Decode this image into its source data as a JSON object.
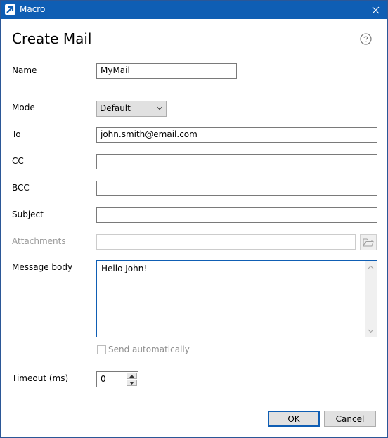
{
  "window": {
    "title": "Macro",
    "close_glyph": "✕"
  },
  "heading": "Create Mail",
  "icons": {
    "app": "arrow-app-icon",
    "help": "question-circle-icon",
    "browse": "folder-open-icon"
  },
  "colors": {
    "titlebar": "#0f5eb4",
    "focus_border": "#0f5eb4"
  },
  "form": {
    "name": {
      "label": "Name",
      "value": "MyMail"
    },
    "mode": {
      "label": "Mode",
      "value": "Default"
    },
    "to": {
      "label": "To",
      "value": "john.smith@email.com"
    },
    "cc": {
      "label": "CC",
      "value": ""
    },
    "bcc": {
      "label": "BCC",
      "value": ""
    },
    "subject": {
      "label": "Subject",
      "value": ""
    },
    "attachments": {
      "label": "Attachments",
      "value": ""
    },
    "message_body": {
      "label": "Message body",
      "value": "Hello John!"
    },
    "send_automatically": {
      "label": "Send automatically",
      "checked": false
    },
    "timeout": {
      "label": "Timeout (ms)",
      "value": "0"
    }
  },
  "buttons": {
    "ok": "OK",
    "cancel": "Cancel"
  }
}
